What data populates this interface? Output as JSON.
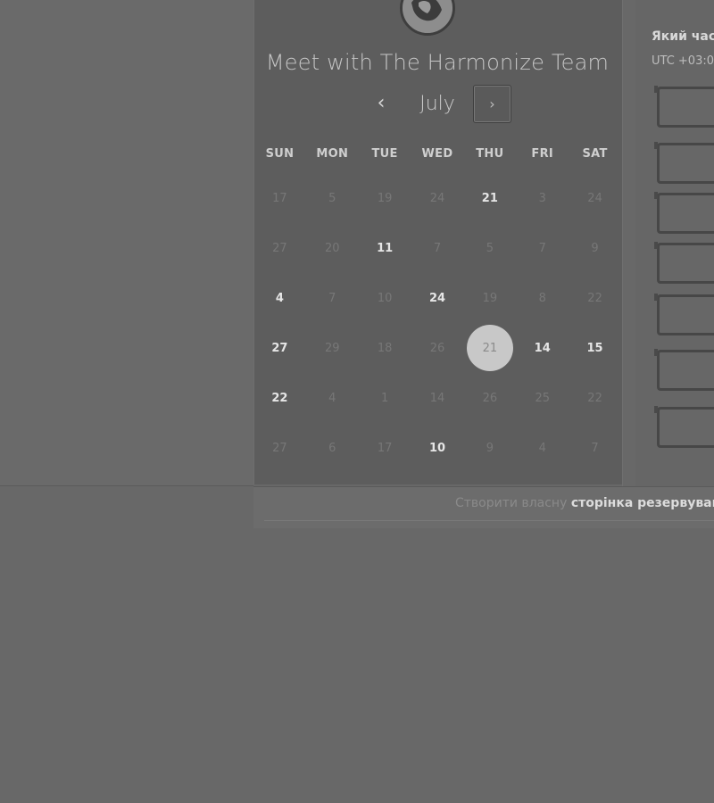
{
  "calendar": {
    "title": "Meet with The Harmonize Team",
    "month": "July",
    "prev_icon": "‹",
    "next_icon": "›",
    "weekdays": [
      "SUN",
      "MON",
      "TUE",
      "WED",
      "THU",
      "FRI",
      "SAT"
    ],
    "weeks": [
      [
        {
          "d": "17",
          "on": false
        },
        {
          "d": "5",
          "on": false
        },
        {
          "d": "19",
          "on": false
        },
        {
          "d": "24",
          "on": false
        },
        {
          "d": "21",
          "on": true
        },
        {
          "d": "3",
          "on": false
        },
        {
          "d": "24",
          "on": false
        }
      ],
      [
        {
          "d": "27",
          "on": false
        },
        {
          "d": "20",
          "on": false
        },
        {
          "d": "11",
          "on": true
        },
        {
          "d": "7",
          "on": false
        },
        {
          "d": "5",
          "on": false
        },
        {
          "d": "7",
          "on": false
        },
        {
          "d": "9",
          "on": false
        }
      ],
      [
        {
          "d": "4",
          "on": true
        },
        {
          "d": "7",
          "on": false
        },
        {
          "d": "10",
          "on": false
        },
        {
          "d": "24",
          "on": true
        },
        {
          "d": "19",
          "on": false
        },
        {
          "d": "8",
          "on": false
        },
        {
          "d": "22",
          "on": false
        }
      ],
      [
        {
          "d": "27",
          "on": true
        },
        {
          "d": "29",
          "on": false
        },
        {
          "d": "18",
          "on": false
        },
        {
          "d": "26",
          "on": false
        },
        {
          "d": "21",
          "on": true,
          "selected": true
        },
        {
          "d": "14",
          "on": true
        },
        {
          "d": "15",
          "on": true
        }
      ],
      [
        {
          "d": "22",
          "on": true
        },
        {
          "d": "4",
          "on": false
        },
        {
          "d": "1",
          "on": false
        },
        {
          "d": "14",
          "on": false
        },
        {
          "d": "26",
          "on": false
        },
        {
          "d": "25",
          "on": false
        },
        {
          "d": "22",
          "on": false
        }
      ],
      [
        {
          "d": "27",
          "on": false
        },
        {
          "d": "6",
          "on": false
        },
        {
          "d": "17",
          "on": false
        },
        {
          "d": "10",
          "on": true
        },
        {
          "d": "9",
          "on": false
        },
        {
          "d": "4",
          "on": false
        },
        {
          "d": "7",
          "on": false
        }
      ]
    ]
  },
  "timezone": {
    "question": "Який час",
    "value": "UTC +03:0"
  },
  "slots_count_visible": 7,
  "footer": {
    "prefix": "Створити власну ",
    "link": "сторінка резервуванн"
  },
  "colors": {
    "background": "#686868",
    "panel": "#5d5d5d",
    "selected_day": "#c8c8c8"
  }
}
